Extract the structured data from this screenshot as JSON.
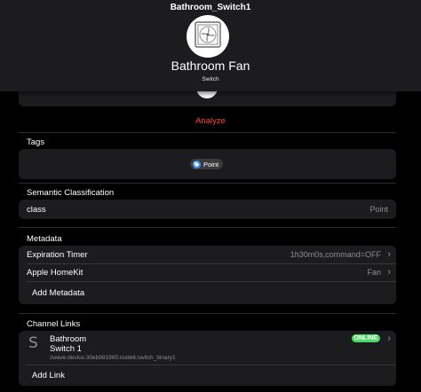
{
  "window": {
    "title": "Bathroom_Switch1"
  },
  "device": {
    "name": "Bathroom Fan",
    "type": "Switch",
    "icon": "fan-icon"
  },
  "analyze_label": "Analyze",
  "tags": {
    "header": "Tags",
    "items": [
      {
        "label": "Point",
        "icon": "tag-icon"
      }
    ]
  },
  "semantic": {
    "header": "Semantic Classification",
    "label": "class",
    "value": "Point"
  },
  "metadata": {
    "header": "Metadata",
    "items": [
      {
        "label": "Expiration Timer",
        "value": "1h30m0s,command=OFF"
      },
      {
        "label": "Apple HomeKit",
        "value": "Fan"
      }
    ],
    "add_label": "Add Metadata"
  },
  "channel_links": {
    "header": "Channel Links",
    "items": [
      {
        "letter": "S",
        "title_line1": "Bathroom",
        "title_line2": "Switch 1",
        "uid": "zwave:device:30eb981965:node6:switch_binary1",
        "status": "ONLINE"
      }
    ],
    "add_label": "Add Link"
  },
  "colors": {
    "background": "#000000",
    "card": "#1c1c1e",
    "accent": "#0a84ff",
    "destructive": "#ff453a",
    "online": "#4cd964"
  }
}
